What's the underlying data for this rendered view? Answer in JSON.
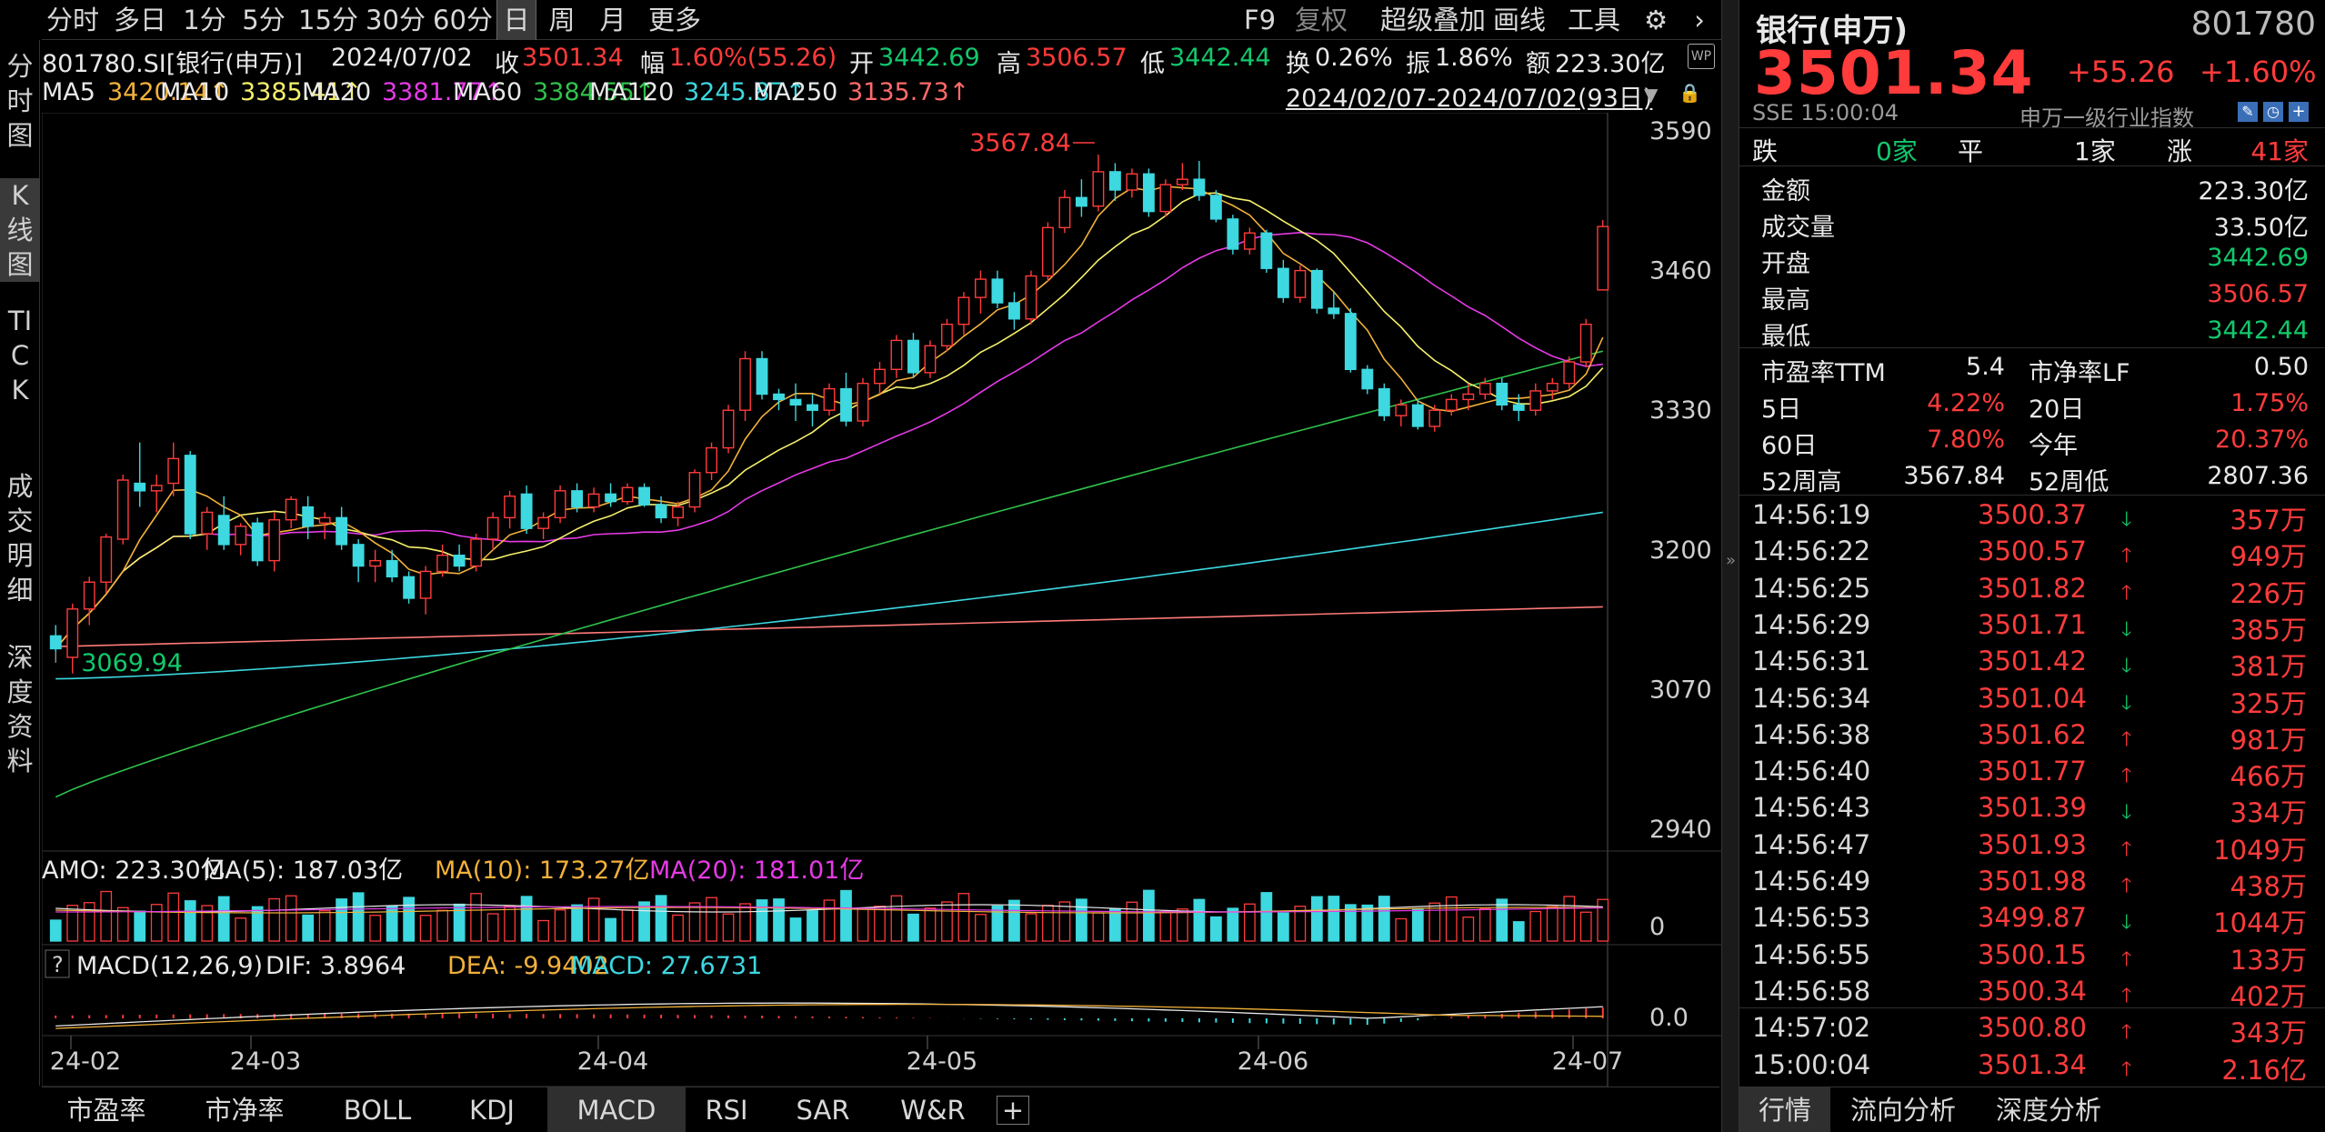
{
  "toolbar": {
    "tabs": [
      "分时",
      "多日",
      "1分",
      "5分",
      "15分",
      "30分",
      "60分",
      "日",
      "周",
      "月",
      "更多"
    ],
    "active": "日",
    "right_items": [
      "F9",
      "复权",
      "超级叠加",
      "画线",
      "工具"
    ]
  },
  "left_tabs": [
    "分时图",
    "K线图",
    "TICK",
    "成交明细",
    "深度资料"
  ],
  "info_line": {
    "code": "801780.SI[银行(申万)]",
    "date": "2024/07/02",
    "close_label": "收",
    "close": "3501.34",
    "change_label": "幅",
    "change": "1.60%(55.26)",
    "open_label": "开",
    "open": "3442.69",
    "high_label": "高",
    "high": "3506.57",
    "low_label": "低",
    "low": "3442.44",
    "turnover_label": "换",
    "turnover": "0.26%",
    "amplitude_label": "振",
    "amplitude": "1.86%",
    "amount_label": "额",
    "amount": "223.30亿"
  },
  "ma_line": [
    {
      "label": "MA5",
      "value": "3420.14↑",
      "color": "#f2b13a"
    },
    {
      "label": "MA10",
      "value": "3385.41↑",
      "color": "#f5f06a"
    },
    {
      "label": "MA20",
      "value": "3381.77↑",
      "color": "#e63ae6"
    },
    {
      "label": "MA60",
      "value": "3384.55↑",
      "color": "#2fc24b"
    },
    {
      "label": "MA120",
      "value": "3245.87↑",
      "color": "#3dd8e0"
    },
    {
      "label": "MA250",
      "value": "3135.73↑",
      "color": "#ff6a6a"
    }
  ],
  "date_range": "2024/02/07-2024/07/02(93日)",
  "chart_data": [
    {
      "type": "candlestick",
      "title": "",
      "y_ticks": [
        "3590",
        "3460",
        "3330",
        "3200",
        "3070",
        "2940"
      ],
      "ylim": [
        2940,
        3590
      ],
      "x_ticks": [
        "24-02",
        "24-03",
        "24-04",
        "24-05",
        "24-06",
        "24-07"
      ],
      "annotations": [
        {
          "text": "3567.84",
          "kind": "high"
        },
        {
          "text": "3069.94",
          "kind": "low"
        }
      ],
      "candles": [
        {
          "o": 3120,
          "h": 3130,
          "l": 3105,
          "c": 3108
        },
        {
          "o": 3100,
          "h": 3150,
          "l": 3085,
          "c": 3145
        },
        {
          "o": 3145,
          "h": 3175,
          "l": 3130,
          "c": 3170
        },
        {
          "o": 3170,
          "h": 3215,
          "l": 3160,
          "c": 3212
        },
        {
          "o": 3210,
          "h": 3270,
          "l": 3205,
          "c": 3265
        },
        {
          "o": 3262,
          "h": 3300,
          "l": 3240,
          "c": 3255
        },
        {
          "o": 3255,
          "h": 3270,
          "l": 3235,
          "c": 3260
        },
        {
          "o": 3262,
          "h": 3300,
          "l": 3250,
          "c": 3285
        },
        {
          "o": 3288,
          "h": 3292,
          "l": 3210,
          "c": 3215
        },
        {
          "o": 3215,
          "h": 3240,
          "l": 3200,
          "c": 3235
        },
        {
          "o": 3232,
          "h": 3250,
          "l": 3200,
          "c": 3205
        },
        {
          "o": 3205,
          "h": 3225,
          "l": 3195,
          "c": 3222
        },
        {
          "o": 3225,
          "h": 3230,
          "l": 3185,
          "c": 3190
        },
        {
          "o": 3190,
          "h": 3235,
          "l": 3180,
          "c": 3228
        },
        {
          "o": 3228,
          "h": 3250,
          "l": 3220,
          "c": 3247
        },
        {
          "o": 3240,
          "h": 3250,
          "l": 3210,
          "c": 3222
        },
        {
          "o": 3225,
          "h": 3235,
          "l": 3210,
          "c": 3230
        },
        {
          "o": 3230,
          "h": 3240,
          "l": 3200,
          "c": 3205
        },
        {
          "o": 3205,
          "h": 3210,
          "l": 3170,
          "c": 3185
        },
        {
          "o": 3185,
          "h": 3200,
          "l": 3170,
          "c": 3190
        },
        {
          "o": 3190,
          "h": 3200,
          "l": 3170,
          "c": 3175
        },
        {
          "o": 3175,
          "h": 3180,
          "l": 3150,
          "c": 3155
        },
        {
          "o": 3155,
          "h": 3185,
          "l": 3140,
          "c": 3180
        },
        {
          "o": 3180,
          "h": 3205,
          "l": 3175,
          "c": 3195
        },
        {
          "o": 3195,
          "h": 3205,
          "l": 3180,
          "c": 3185
        },
        {
          "o": 3185,
          "h": 3215,
          "l": 3180,
          "c": 3210
        },
        {
          "o": 3210,
          "h": 3235,
          "l": 3200,
          "c": 3230
        },
        {
          "o": 3230,
          "h": 3255,
          "l": 3220,
          "c": 3250
        },
        {
          "o": 3252,
          "h": 3260,
          "l": 3215,
          "c": 3220
        },
        {
          "o": 3220,
          "h": 3235,
          "l": 3210,
          "c": 3230
        },
        {
          "o": 3230,
          "h": 3260,
          "l": 3225,
          "c": 3255
        },
        {
          "o": 3255,
          "h": 3262,
          "l": 3235,
          "c": 3240
        },
        {
          "o": 3240,
          "h": 3258,
          "l": 3235,
          "c": 3252
        },
        {
          "o": 3252,
          "h": 3262,
          "l": 3240,
          "c": 3245
        },
        {
          "o": 3245,
          "h": 3262,
          "l": 3242,
          "c": 3258
        },
        {
          "o": 3258,
          "h": 3262,
          "l": 3240,
          "c": 3242
        },
        {
          "o": 3242,
          "h": 3250,
          "l": 3225,
          "c": 3230
        },
        {
          "o": 3230,
          "h": 3245,
          "l": 3222,
          "c": 3240
        },
        {
          "o": 3240,
          "h": 3275,
          "l": 3235,
          "c": 3272
        },
        {
          "o": 3272,
          "h": 3300,
          "l": 3265,
          "c": 3295
        },
        {
          "o": 3295,
          "h": 3335,
          "l": 3290,
          "c": 3330
        },
        {
          "o": 3330,
          "h": 3385,
          "l": 3320,
          "c": 3378
        },
        {
          "o": 3378,
          "h": 3385,
          "l": 3340,
          "c": 3345
        },
        {
          "o": 3345,
          "h": 3350,
          "l": 3330,
          "c": 3340
        },
        {
          "o": 3340,
          "h": 3355,
          "l": 3320,
          "c": 3335
        },
        {
          "o": 3335,
          "h": 3345,
          "l": 3315,
          "c": 3330
        },
        {
          "o": 3330,
          "h": 3355,
          "l": 3325,
          "c": 3350
        },
        {
          "o": 3350,
          "h": 3365,
          "l": 3315,
          "c": 3320
        },
        {
          "o": 3320,
          "h": 3360,
          "l": 3315,
          "c": 3355
        },
        {
          "o": 3355,
          "h": 3375,
          "l": 3345,
          "c": 3368
        },
        {
          "o": 3368,
          "h": 3400,
          "l": 3360,
          "c": 3395
        },
        {
          "o": 3395,
          "h": 3402,
          "l": 3360,
          "c": 3365
        },
        {
          "o": 3365,
          "h": 3395,
          "l": 3360,
          "c": 3390
        },
        {
          "o": 3390,
          "h": 3415,
          "l": 3385,
          "c": 3410
        },
        {
          "o": 3410,
          "h": 3440,
          "l": 3400,
          "c": 3435
        },
        {
          "o": 3435,
          "h": 3460,
          "l": 3420,
          "c": 3452
        },
        {
          "o": 3452,
          "h": 3460,
          "l": 3425,
          "c": 3430
        },
        {
          "o": 3430,
          "h": 3440,
          "l": 3405,
          "c": 3415
        },
        {
          "o": 3415,
          "h": 3460,
          "l": 3410,
          "c": 3455
        },
        {
          "o": 3455,
          "h": 3505,
          "l": 3450,
          "c": 3500
        },
        {
          "o": 3500,
          "h": 3535,
          "l": 3495,
          "c": 3528
        },
        {
          "o": 3528,
          "h": 3545,
          "l": 3510,
          "c": 3520
        },
        {
          "o": 3520,
          "h": 3568,
          "l": 3515,
          "c": 3552
        },
        {
          "o": 3552,
          "h": 3560,
          "l": 3525,
          "c": 3535
        },
        {
          "o": 3535,
          "h": 3555,
          "l": 3528,
          "c": 3550
        },
        {
          "o": 3550,
          "h": 3555,
          "l": 3510,
          "c": 3515
        },
        {
          "o": 3515,
          "h": 3545,
          "l": 3510,
          "c": 3540
        },
        {
          "o": 3540,
          "h": 3560,
          "l": 3535,
          "c": 3545
        },
        {
          "o": 3545,
          "h": 3562,
          "l": 3525,
          "c": 3530
        },
        {
          "o": 3530,
          "h": 3535,
          "l": 3505,
          "c": 3508
        },
        {
          "o": 3508,
          "h": 3512,
          "l": 3475,
          "c": 3480
        },
        {
          "o": 3480,
          "h": 3500,
          "l": 3475,
          "c": 3495
        },
        {
          "o": 3495,
          "h": 3498,
          "l": 3458,
          "c": 3462
        },
        {
          "o": 3462,
          "h": 3470,
          "l": 3430,
          "c": 3435
        },
        {
          "o": 3435,
          "h": 3465,
          "l": 3430,
          "c": 3460
        },
        {
          "o": 3460,
          "h": 3462,
          "l": 3420,
          "c": 3425
        },
        {
          "o": 3425,
          "h": 3440,
          "l": 3415,
          "c": 3420
        },
        {
          "o": 3420,
          "h": 3425,
          "l": 3365,
          "c": 3368
        },
        {
          "o": 3368,
          "h": 3372,
          "l": 3345,
          "c": 3350
        },
        {
          "o": 3350,
          "h": 3355,
          "l": 3320,
          "c": 3325
        },
        {
          "o": 3325,
          "h": 3340,
          "l": 3315,
          "c": 3335
        },
        {
          "o": 3335,
          "h": 3340,
          "l": 3312,
          "c": 3315
        },
        {
          "o": 3315,
          "h": 3335,
          "l": 3310,
          "c": 3330
        },
        {
          "o": 3330,
          "h": 3345,
          "l": 3325,
          "c": 3340
        },
        {
          "o": 3340,
          "h": 3355,
          "l": 3330,
          "c": 3345
        },
        {
          "o": 3345,
          "h": 3360,
          "l": 3340,
          "c": 3355
        },
        {
          "o": 3355,
          "h": 3360,
          "l": 3330,
          "c": 3335
        },
        {
          "o": 3335,
          "h": 3345,
          "l": 3320,
          "c": 3330
        },
        {
          "o": 3330,
          "h": 3355,
          "l": 3325,
          "c": 3348
        },
        {
          "o": 3348,
          "h": 3360,
          "l": 3340,
          "c": 3355
        },
        {
          "o": 3355,
          "h": 3380,
          "l": 3350,
          "c": 3375
        },
        {
          "o": 3375,
          "h": 3415,
          "l": 3370,
          "c": 3410
        },
        {
          "o": 3442,
          "h": 3507,
          "l": 3442,
          "c": 3501
        }
      ]
    },
    {
      "type": "bar",
      "title": "AMO",
      "legend": [
        {
          "label": "AMO: 223.30亿",
          "color": "#e8e8e8"
        },
        {
          "label": "MA(5): 187.03亿",
          "color": "#e8e8e8"
        },
        {
          "label": "MA(10): 173.27亿",
          "color": "#f2b13a"
        },
        {
          "label": "MA(20): 181.01亿",
          "color": "#e63ae6"
        }
      ],
      "y_ticks": [
        "0"
      ]
    },
    {
      "type": "line",
      "title": "MACD(12,26,9)",
      "legend": [
        {
          "label": "DIF: 3.8964",
          "color": "#e8e8e8"
        },
        {
          "label": "DEA: -9.9402",
          "color": "#f2b13a"
        },
        {
          "label": "MACD: 27.6731",
          "color": "#3dd8e0"
        }
      ],
      "y_ticks": [
        "0.0"
      ]
    }
  ],
  "bottom_tabs": [
    "市盈率",
    "市净率",
    "BOLL",
    "KDJ",
    "MACD",
    "RSI",
    "SAR",
    "W&R",
    "+"
  ],
  "bottom_active": "MACD",
  "right_panel": {
    "name": "银行(申万)",
    "code": "801780",
    "price": "3501.34",
    "change": "+55.26",
    "change_pct": "+1.60%",
    "exchange_time": "SSE  15:00:04",
    "category": "申万一级行业指数",
    "breadth": {
      "down_label": "跌",
      "down": "0家",
      "flat_label": "平",
      "flat": "1家",
      "up_label": "涨",
      "up": "41家"
    },
    "stats": [
      {
        "label": "金额",
        "value": "223.30亿",
        "color": "wht"
      },
      {
        "label": "成交量",
        "value": "33.50亿",
        "color": "wht"
      },
      {
        "label": "开盘",
        "value": "3442.69",
        "color": "grn"
      },
      {
        "label": "最高",
        "value": "3506.57",
        "color": "red"
      },
      {
        "label": "最低",
        "value": "3442.44",
        "color": "grn"
      }
    ],
    "ratios": [
      {
        "l1": "市盈率TTM",
        "v1": "5.4",
        "c1": "wht",
        "l2": "市净率LF",
        "v2": "0.50",
        "c2": "wht"
      },
      {
        "l1": "5日",
        "v1": "4.22%",
        "c1": "red",
        "l2": "20日",
        "v2": "1.75%",
        "c2": "red"
      },
      {
        "l1": "60日",
        "v1": "7.80%",
        "c1": "red",
        "l2": "今年",
        "v2": "20.37%",
        "c2": "red"
      },
      {
        "l1": "52周高",
        "v1": "3567.84",
        "c1": "wht",
        "l2": "52周低",
        "v2": "2807.36",
        "c2": "wht"
      }
    ],
    "ticks": [
      {
        "time": "14:56:19",
        "price": "3500.37",
        "dir": "down",
        "vol": "357万"
      },
      {
        "time": "14:56:22",
        "price": "3500.57",
        "dir": "up",
        "vol": "949万"
      },
      {
        "time": "14:56:25",
        "price": "3501.82",
        "dir": "up",
        "vol": "226万"
      },
      {
        "time": "14:56:29",
        "price": "3501.71",
        "dir": "down",
        "vol": "385万"
      },
      {
        "time": "14:56:31",
        "price": "3501.42",
        "dir": "down",
        "vol": "381万"
      },
      {
        "time": "14:56:34",
        "price": "3501.04",
        "dir": "down",
        "vol": "325万"
      },
      {
        "time": "14:56:38",
        "price": "3501.62",
        "dir": "up",
        "vol": "981万"
      },
      {
        "time": "14:56:40",
        "price": "3501.77",
        "dir": "up",
        "vol": "466万"
      },
      {
        "time": "14:56:43",
        "price": "3501.39",
        "dir": "down",
        "vol": "334万"
      },
      {
        "time": "14:56:47",
        "price": "3501.93",
        "dir": "up",
        "vol": "1049万"
      },
      {
        "time": "14:56:49",
        "price": "3501.98",
        "dir": "up",
        "vol": "438万"
      },
      {
        "time": "14:56:53",
        "price": "3499.87",
        "dir": "down",
        "vol": "1044万"
      },
      {
        "time": "14:56:55",
        "price": "3500.15",
        "dir": "up",
        "vol": "133万"
      },
      {
        "time": "14:56:58",
        "price": "3500.34",
        "dir": "up",
        "vol": "402万"
      },
      {
        "time": "14:57:02",
        "price": "3500.80",
        "dir": "up",
        "vol": "343万"
      },
      {
        "time": "15:00:04",
        "price": "3501.34",
        "dir": "up",
        "vol": "2.16亿"
      }
    ],
    "bottom_tabs": [
      "行情",
      "流向分析",
      "深度分析"
    ],
    "bottom_active": "行情"
  }
}
